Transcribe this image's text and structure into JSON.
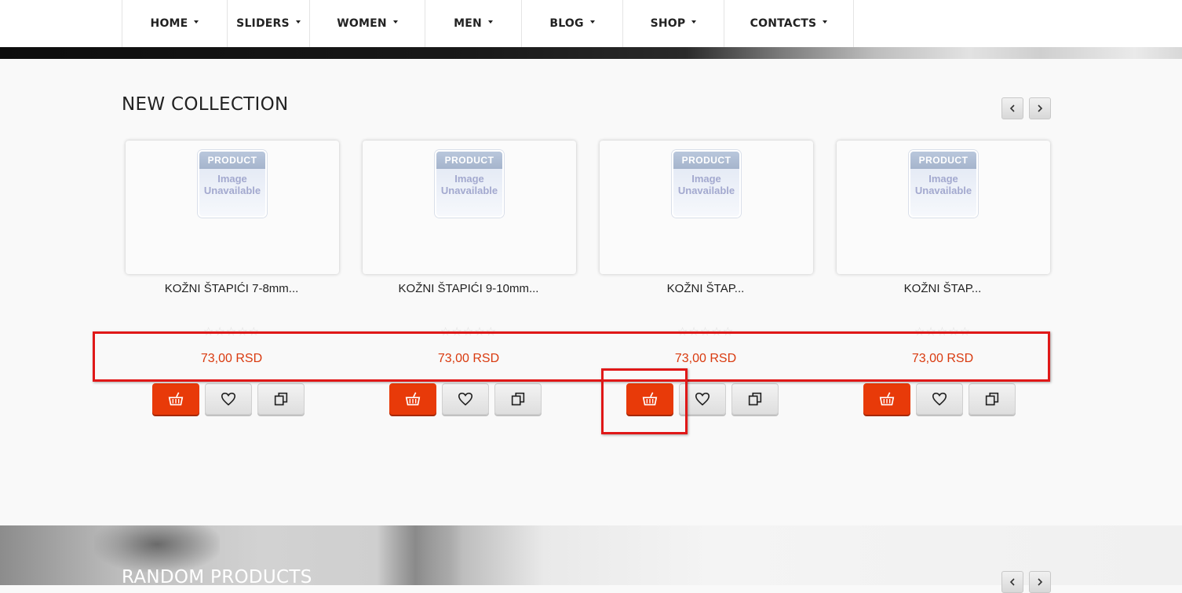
{
  "nav": {
    "items": [
      {
        "label": "HOME"
      },
      {
        "label": "SLIDERS"
      },
      {
        "label": "WOMEN"
      },
      {
        "label": "MEN"
      },
      {
        "label": "BLOG"
      },
      {
        "label": "SHOP"
      },
      {
        "label": "CONTACTS"
      }
    ]
  },
  "new_collection": {
    "title": "NEW COLLECTION",
    "products": [
      {
        "name": "KOŽNI ŠTAPIĆI 7-8mm...",
        "price": "73,00 RSD",
        "rating": 0,
        "image": {
          "top": "PRODUCT",
          "line1": "Image",
          "line2": "Unavailable"
        }
      },
      {
        "name": "KOŽNI ŠTAPIĆI 9-10mm...",
        "price": "73,00 RSD",
        "rating": 0,
        "image": {
          "top": "PRODUCT",
          "line1": "Image",
          "line2": "Unavailable"
        }
      },
      {
        "name": "KOŽNI ŠTAP...",
        "price": "73,00 RSD",
        "rating": 0,
        "image": {
          "top": "PRODUCT",
          "line1": "Image",
          "line2": "Unavailable"
        }
      },
      {
        "name": "KOŽNI ŠTAP...",
        "price": "73,00 RSD",
        "rating": 0,
        "image": {
          "top": "PRODUCT",
          "line1": "Image",
          "line2": "Unavailable"
        }
      }
    ],
    "rating_stars": "☆☆☆☆☆",
    "icons": {
      "cart": "basket-icon",
      "wishlist": "heart-icon",
      "compare": "compare-icon",
      "prev": "chevron-left-icon",
      "next": "chevron-right-icon"
    }
  },
  "random_products": {
    "title": "RANDOM PRODUCTS"
  },
  "colors": {
    "accent": "#e83a09",
    "price": "#d93a0f",
    "annotation": "#e01818"
  }
}
